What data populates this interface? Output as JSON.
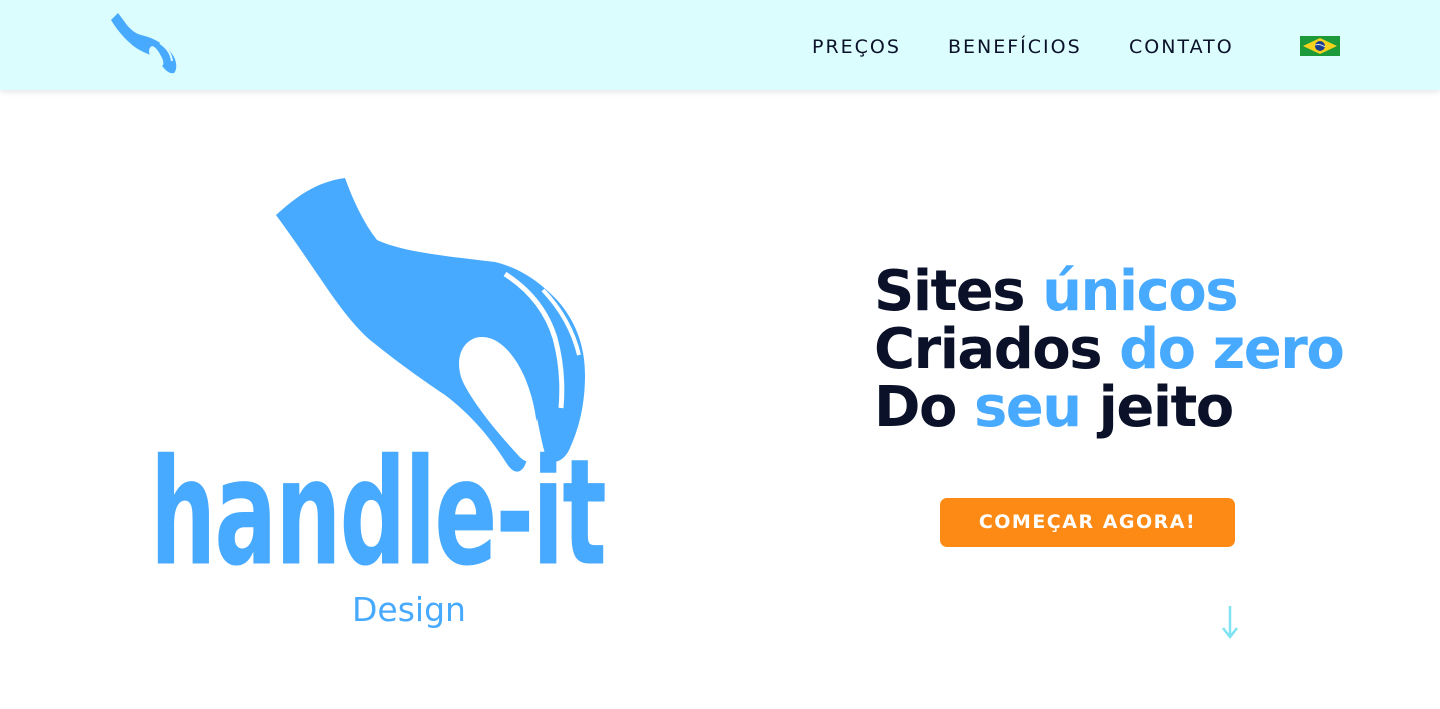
{
  "nav": {
    "items": [
      {
        "label": "PREÇOS"
      },
      {
        "label": "BENEFÍCIOS"
      },
      {
        "label": "CONTATO"
      }
    ],
    "language_flag": "brazil-flag-icon",
    "logo_icon": "hand-logo-icon"
  },
  "hero": {
    "brand_word": "handle-it",
    "brand_sub": "Design",
    "headline": {
      "line1": {
        "plain": "Sites ",
        "accent": "únicos"
      },
      "line2": {
        "plain": "Criados ",
        "accent": "do zero"
      },
      "line3": {
        "plain": "Do ",
        "accent": "seu",
        "plain_after": " jeito"
      }
    },
    "cta_label": "COMEÇAR AGORA!",
    "scroll_icon": "arrow-down-icon"
  },
  "colors": {
    "topbar_bg": "#dbfdfe",
    "accent_blue": "#47aaff",
    "dark_text": "#0b1128",
    "cta_orange": "#fd8a14",
    "arrow_cyan": "#7fe3f4"
  }
}
